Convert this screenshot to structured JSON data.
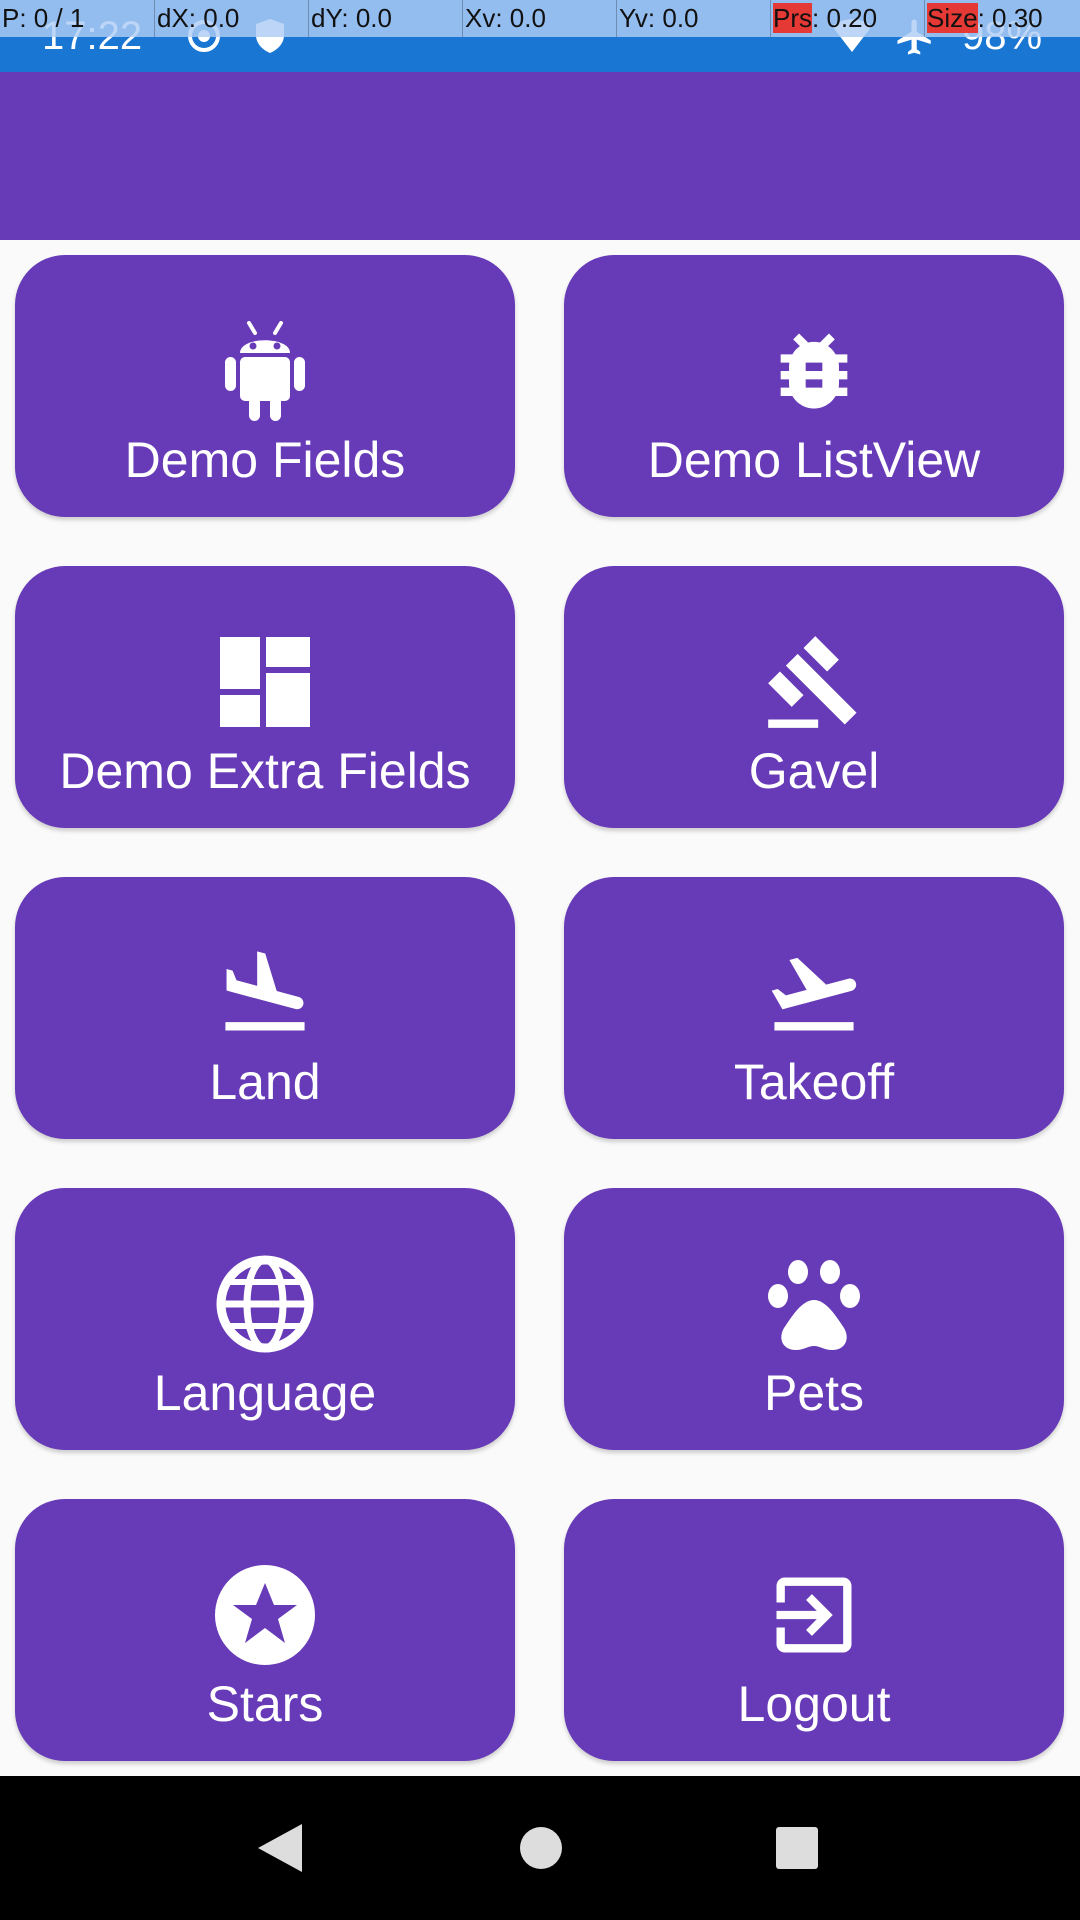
{
  "status_bar": {
    "time": "17:22",
    "battery": "98%",
    "icons": [
      "sync-icon",
      "shield-icon",
      "wifi-icon",
      "airplane-icon"
    ],
    "color": "#1976d2"
  },
  "pointer_overlay": {
    "p": "P: 0 / 1",
    "dx": "dX: 0.0",
    "dy": "dY: 0.0",
    "xv": "Xv: 0.0",
    "yv": "Yv: 0.0",
    "prs_label": "Prs",
    "prs_value": ": 0.20",
    "size_label": "Size",
    "size_value": ": 0.30"
  },
  "app_bar": {
    "color": "#673ab7"
  },
  "tiles": [
    {
      "label": "Demo Fields",
      "icon": "android-icon"
    },
    {
      "label": "Demo ListView",
      "icon": "bug-icon"
    },
    {
      "label": "Demo Extra Fields",
      "icon": "dashboard-icon"
    },
    {
      "label": "Gavel",
      "icon": "gavel-icon"
    },
    {
      "label": "Land",
      "icon": "flight-land-icon"
    },
    {
      "label": "Takeoff",
      "icon": "flight-takeoff-icon"
    },
    {
      "label": "Language",
      "icon": "globe-icon"
    },
    {
      "label": "Pets",
      "icon": "paw-icon"
    },
    {
      "label": "Stars",
      "icon": "star-circle-icon"
    },
    {
      "label": "Logout",
      "icon": "exit-icon"
    }
  ],
  "nav_bar": {
    "buttons": [
      "back-icon",
      "home-icon",
      "recents-icon"
    ]
  },
  "colors": {
    "accent": "#673ab7",
    "background": "#fafafa"
  }
}
